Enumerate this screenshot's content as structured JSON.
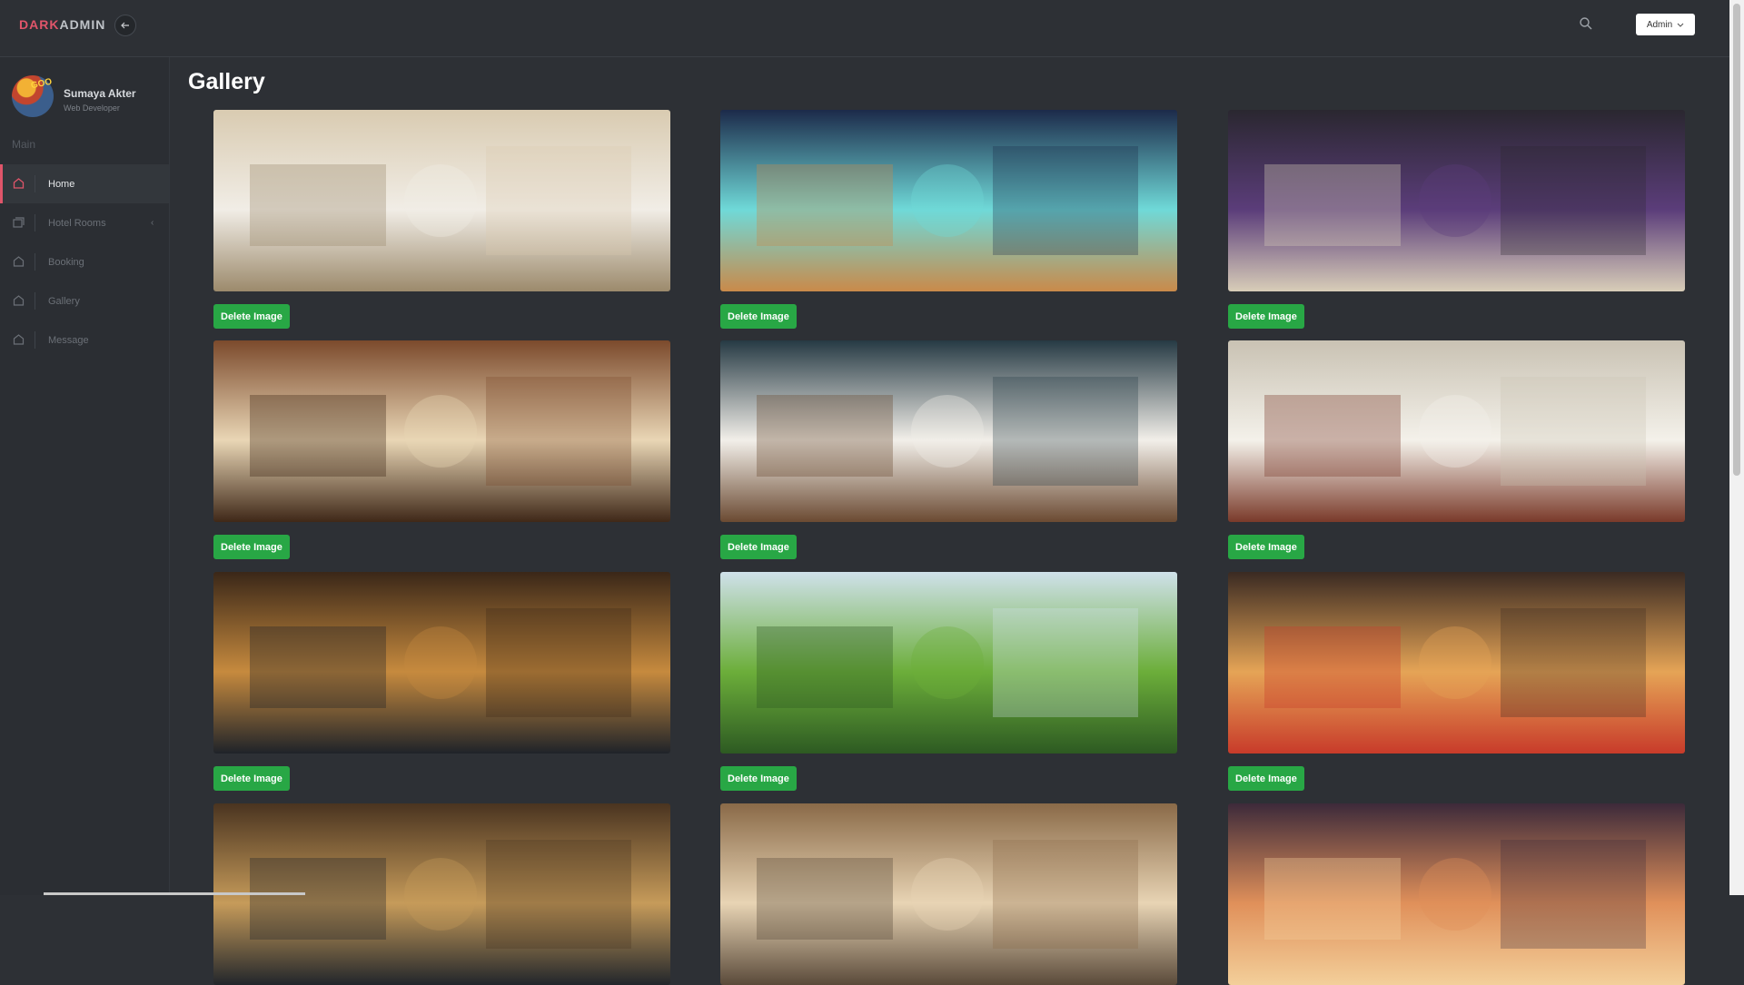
{
  "brand": {
    "part1": "DARK",
    "part2": "ADMIN"
  },
  "header": {
    "admin_label": "Admin"
  },
  "profile": {
    "name": "Sumaya Akter",
    "role": "Web Developer",
    "avatar_badge": "GOO"
  },
  "sidebar": {
    "section_label": "Main",
    "items": [
      {
        "label": "Home",
        "active": true
      },
      {
        "label": "Hotel Rooms",
        "has_chevron": true
      },
      {
        "label": "Booking"
      },
      {
        "label": "Gallery"
      },
      {
        "label": "Message"
      }
    ]
  },
  "page": {
    "title": "Gallery"
  },
  "gallery": {
    "delete_label": "Delete Image",
    "images": [
      {
        "subject": "hotel bedroom with sea view",
        "colors": [
          "#d9cbb1",
          "#f1ede6",
          "#9c8a6c"
        ]
      },
      {
        "subject": "resort pool at night",
        "colors": [
          "#1c2a4a",
          "#6fd9d8",
          "#c98a4a"
        ]
      },
      {
        "subject": "grand lobby with staircase",
        "colors": [
          "#2a2730",
          "#5b3d7a",
          "#d8cdb8"
        ]
      },
      {
        "subject": "hotel lounge seating",
        "colors": [
          "#7b4a2c",
          "#e9d6b5",
          "#3f2818"
        ]
      },
      {
        "subject": "smiling receptionist",
        "colors": [
          "#263a44",
          "#f2efe9",
          "#6b4a32"
        ]
      },
      {
        "subject": "hotel restaurant dining hall",
        "colors": [
          "#c9c2b3",
          "#f4f1ea",
          "#7a3a2a"
        ]
      },
      {
        "subject": "front desk check-in",
        "colors": [
          "#3a2718",
          "#c68a3e",
          "#1f2329"
        ]
      },
      {
        "subject": "garden with sun loungers",
        "colors": [
          "#cfe1ea",
          "#6cae3a",
          "#2d5a22"
        ]
      },
      {
        "subject": "breakfast buffet",
        "colors": [
          "#3a2a22",
          "#e5a456",
          "#c83b2a"
        ]
      },
      {
        "subject": "lobby with luggage",
        "colors": [
          "#4a3420",
          "#c69b5a",
          "#22262b"
        ]
      },
      {
        "subject": "ornate hallway with mirrors",
        "colors": [
          "#8a6a48",
          "#e8d4b4",
          "#5a4a3a"
        ]
      },
      {
        "subject": "palace hotel exterior at dusk",
        "colors": [
          "#3d2a3a",
          "#e0905a",
          "#f3cf9a"
        ]
      }
    ]
  },
  "colors": {
    "accent": "#e0556a",
    "button_green": "#28a745",
    "background": "#2d3035"
  }
}
